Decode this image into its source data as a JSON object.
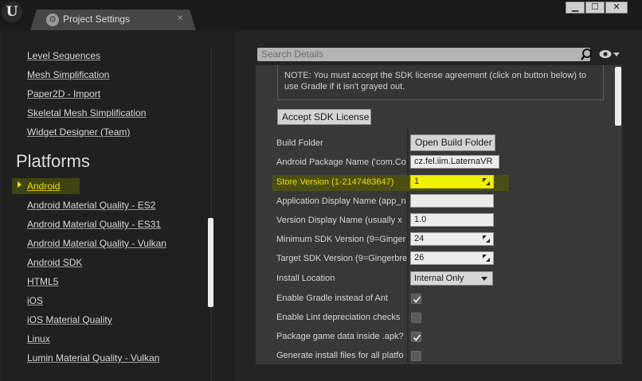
{
  "window": {
    "tab_title": "Project Settings",
    "minimize": "▁",
    "maximize": "☐",
    "close": "✕",
    "tab_close": "✕"
  },
  "sidebar": {
    "items_top": [
      "Level Sequences",
      "Mesh Simplification",
      "Paper2D - Import",
      "Skeletal Mesh Simplification",
      "Widget Designer (Team)"
    ],
    "section_title": "Platforms",
    "items_platforms": [
      "Android",
      "Android Material Quality - ES2",
      "Android Material Quality - ES31",
      "Android Material Quality - Vulkan",
      "Android SDK",
      "HTML5",
      "iOS",
      "iOS Material Quality",
      "Linux",
      "Lumin Material Quality - Vulkan"
    ],
    "active_item": "Android"
  },
  "details": {
    "search_placeholder": "Search Details",
    "note_bold": "NOTE",
    "note_text": ": You must accept the SDK license agreement (click on button below) to use Gradle if it isn't grayed out.",
    "accept_button": "Accept SDK License",
    "properties": [
      {
        "label": "Build Folder",
        "kind": "button",
        "value": "Open Build Folder"
      },
      {
        "label": "Android Package Name ('com.Co",
        "kind": "text",
        "value": "cz.fel.iim.LaternaVR"
      },
      {
        "label": "Store Version (1-2147483647)",
        "kind": "spin",
        "value": "1",
        "highlight": true
      },
      {
        "label": "Application Display Name (app_n",
        "kind": "text",
        "value": ""
      },
      {
        "label": "Version Display Name (usually x",
        "kind": "text",
        "value": "1.0"
      },
      {
        "label": "Minimum SDK Version (9=Ginger",
        "kind": "spin",
        "value": "24"
      },
      {
        "label": "Target SDK Version (9=Gingerbre",
        "kind": "spin",
        "value": "26"
      },
      {
        "label": "Install Location",
        "kind": "combo",
        "value": "Internal Only"
      },
      {
        "label": "Enable Gradle instead of Ant",
        "kind": "check",
        "checked": true
      },
      {
        "label": "Enable Lint depreciation checks",
        "kind": "check",
        "checked": false
      },
      {
        "label": "Package game data inside .apk?",
        "kind": "check",
        "checked": true
      },
      {
        "label": "Generate install files for all platfo",
        "kind": "check",
        "checked": false
      }
    ]
  },
  "colors": {
    "highlight": "#f0f000",
    "active_arrow": "#f0e000",
    "panel_bg": "#202020",
    "details_bg": "#383838"
  }
}
